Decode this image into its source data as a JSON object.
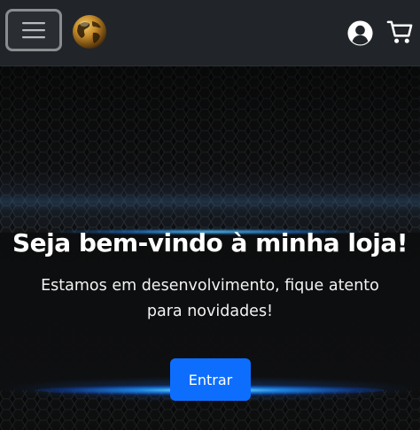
{
  "navbar": {
    "menu_icon": "hamburger-menu-icon",
    "logo_icon": "golden-globe-logo",
    "user_icon": "user-circle-icon",
    "cart_icon": "shopping-cart-icon",
    "background": "#212529"
  },
  "hero": {
    "title": "Seja bem-vindo à minha loja!",
    "subtitle": "Estamos em desenvolvimento, fique atento para novidades!",
    "button_label": "Entrar",
    "button_color": "#0d6efd",
    "glow_color": "#1e90ff"
  }
}
